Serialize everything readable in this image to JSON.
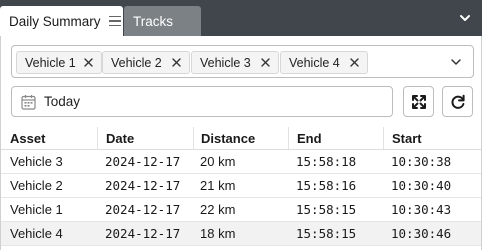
{
  "tabs": [
    {
      "label": "Daily Summary",
      "active": true
    },
    {
      "label": "Tracks",
      "active": false
    }
  ],
  "vehicle_select": {
    "chips": [
      "Vehicle 1",
      "Vehicle 2",
      "Vehicle 3",
      "Vehicle 4"
    ]
  },
  "date_filter": {
    "value": "Today"
  },
  "table": {
    "columns": [
      "Asset",
      "Date",
      "Distance",
      "End",
      "Start"
    ],
    "rows": [
      {
        "asset": "Vehicle 3",
        "date": "2024-12-17",
        "distance": "20 km",
        "end": "15:58:18",
        "start": "10:30:38"
      },
      {
        "asset": "Vehicle 2",
        "date": "2024-12-17",
        "distance": "21 km",
        "end": "15:58:16",
        "start": "10:30:40"
      },
      {
        "asset": "Vehicle 1",
        "date": "2024-12-17",
        "distance": "22 km",
        "end": "15:58:15",
        "start": "10:30:43"
      },
      {
        "asset": "Vehicle 4",
        "date": "2024-12-17",
        "distance": "18 km",
        "end": "15:58:15",
        "start": "10:30:46"
      }
    ]
  },
  "colors": {
    "tabbar_bg": "#41464c",
    "inactive_tab_bg": "#7c8186",
    "alt_row_bg": "#f2f2f2"
  }
}
